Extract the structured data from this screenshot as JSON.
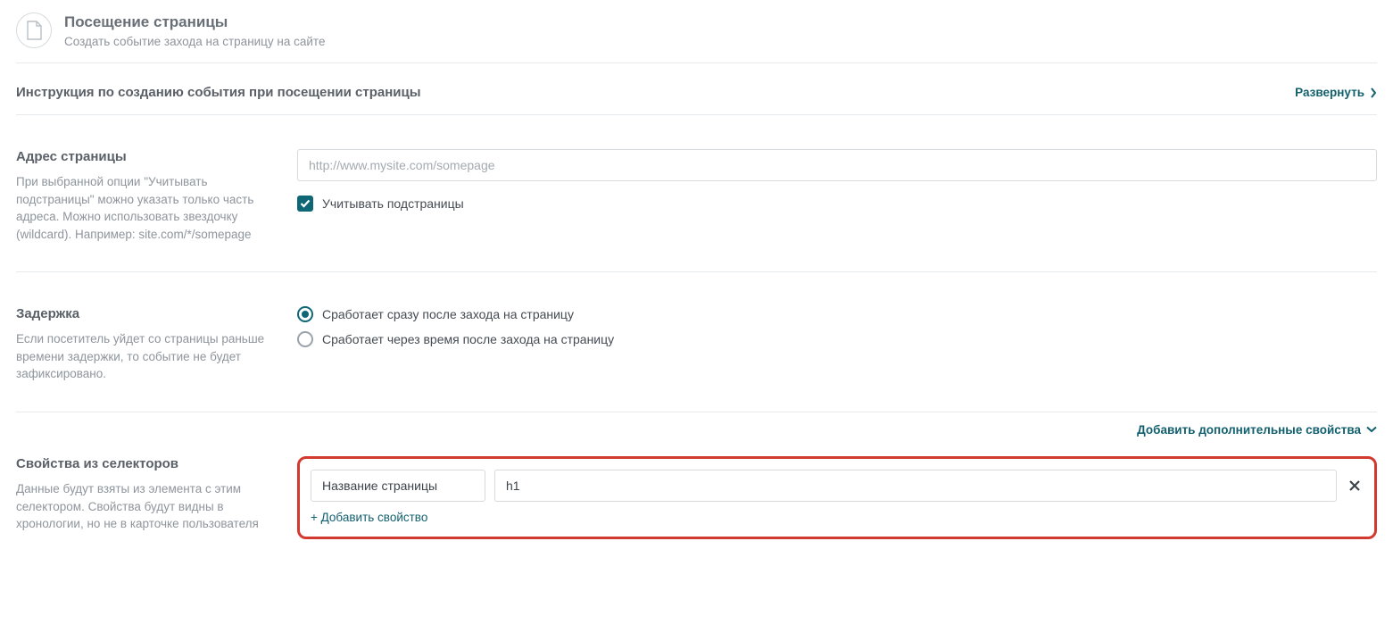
{
  "header": {
    "title": "Посещение страницы",
    "subtitle": "Создать событие захода на страницу на сайте"
  },
  "instruction": {
    "title": "Инструкция по созданию события при посещении страницы",
    "expand_label": "Развернуть"
  },
  "address": {
    "label": "Адрес страницы",
    "help": "При выбранной опции \"Учитывать подстраницы\" можно указать только часть адреса. Можно использовать звездочку (wildcard). Например: site.com/*/somepage",
    "placeholder": "http://www.mysite.com/somepage",
    "value": "",
    "subpages_checked": true,
    "subpages_label": "Учитывать подстраницы"
  },
  "delay": {
    "label": "Задержка",
    "help": "Если посетитель уйдет со страницы раньше времени задержки, то событие не будет зафиксировано.",
    "option_immediate": "Сработает сразу после захода на страницу",
    "option_delayed": "Сработает через время после захода на страницу",
    "selected": "immediate"
  },
  "additional_props": {
    "link_label": "Добавить дополнительные свойства"
  },
  "selectors": {
    "label": "Свойства из селекторов",
    "help": "Данные будут взяты из элемента с этим селектором. Свойства будут видны в хронологии, но не в карточке пользователя",
    "rows": [
      {
        "name": "Название страницы",
        "selector": "h1"
      }
    ],
    "add_label": "+ Добавить свойство"
  }
}
